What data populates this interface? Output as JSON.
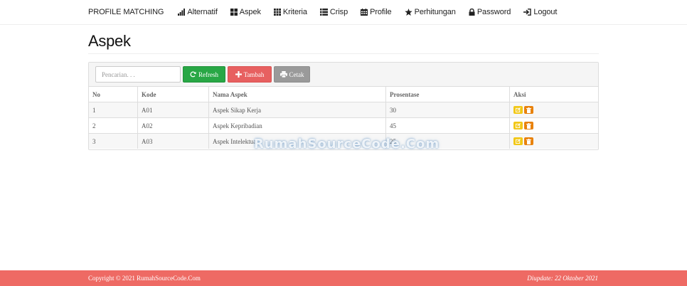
{
  "navbar": {
    "brand": "PROFILE MATCHING",
    "items": [
      {
        "label": "Alternatif",
        "icon": "signal-icon"
      },
      {
        "label": "Aspek",
        "icon": "th-large-icon"
      },
      {
        "label": "Kriteria",
        "icon": "th-icon"
      },
      {
        "label": "Crisp",
        "icon": "list-icon"
      },
      {
        "label": "Profile",
        "icon": "calendar-icon"
      },
      {
        "label": "Perhitungan",
        "icon": "star-icon"
      },
      {
        "label": "Password",
        "icon": "lock-icon"
      },
      {
        "label": "Logout",
        "icon": "log-in-icon"
      }
    ]
  },
  "page": {
    "title": "Aspek"
  },
  "toolbar": {
    "search_placeholder": "Pencarian. . .",
    "search_value": "",
    "refresh_label": "Refresh",
    "tambah_label": "Tambah",
    "cetak_label": "Cetak"
  },
  "table": {
    "headers": [
      "No",
      "Kode",
      "Nama Aspek",
      "Prosentase",
      "Aksi"
    ],
    "rows": [
      {
        "no": "1",
        "kode": "A01",
        "nama": "Aspek Sikap Kerja",
        "prosentase": "30"
      },
      {
        "no": "2",
        "kode": "A02",
        "nama": "Aspek Kepribadian",
        "prosentase": "45"
      },
      {
        "no": "3",
        "kode": "A03",
        "nama": "Aspek Intelektual",
        "prosentase": "25"
      }
    ]
  },
  "watermark": "RumahSourceCode.Com",
  "footer": {
    "copyright": "Copyright © 2021 RumahSourceCode.Com",
    "updated": "Diupdate: 22 Oktober 2021"
  },
  "colors": {
    "refresh": "#28a745",
    "tambah": "#e76060",
    "cetak": "#9a9a9a",
    "edit": "#f2c818",
    "delete": "#e8820c",
    "footer": "#ee6a64"
  }
}
